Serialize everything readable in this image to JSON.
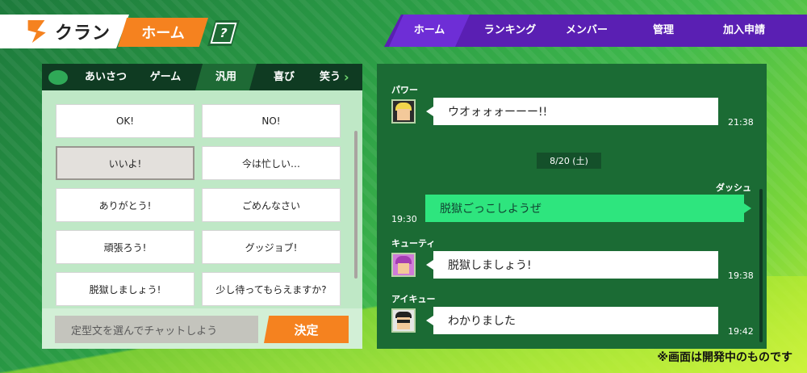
{
  "header": {
    "title": "クラン",
    "home_tab": "ホーム",
    "help_label": "?"
  },
  "nav": {
    "items": [
      "ホーム",
      "ランキング",
      "メンバー",
      "管理",
      "加入申請"
    ],
    "active_index": 0,
    "accent": "#5a1fb3"
  },
  "categories": {
    "icon": "chat-bubble-icon",
    "items": [
      "あいさつ",
      "ゲーム",
      "汎用",
      "喜び",
      "笑う"
    ],
    "active": "汎用",
    "more_icon": "chevron-right-icon"
  },
  "phrases": [
    "OK!",
    "NO!",
    "いいよ!",
    "今は忙しい…",
    "ありがとう!",
    "ごめんなさい",
    "頑張ろう!",
    "グッジョブ!",
    "脱獄しましょう!",
    "少し待ってもらえますか?"
  ],
  "selected_phrase": "いいよ!",
  "input": {
    "placeholder": "定型文を選んでチャットしよう",
    "submit": "決定"
  },
  "chat": {
    "date_separator": "8/20 (土)",
    "messages": [
      {
        "sender": "パワー",
        "text": "ウオォォォーーー!!",
        "time": "21:38",
        "mine": false,
        "avatar": "blonde-avatar-icon"
      },
      {
        "sender": "ダッシュ",
        "text": "脱獄ごっこしようぜ",
        "time": "19:30",
        "mine": true
      },
      {
        "sender": "キューティ",
        "text": "脱獄しましょう!",
        "time": "19:38",
        "mine": false,
        "avatar": "pink-hair-avatar-icon"
      },
      {
        "sender": "アイキュー",
        "text": "わかりました",
        "time": "19:42",
        "mine": false,
        "avatar": "glasses-avatar-icon"
      }
    ]
  },
  "footer_note": "※画面は開発中のものです",
  "colors": {
    "orange": "#f5821f",
    "dark_green": "#1b6b34",
    "my_bubble": "#2ee57e"
  }
}
